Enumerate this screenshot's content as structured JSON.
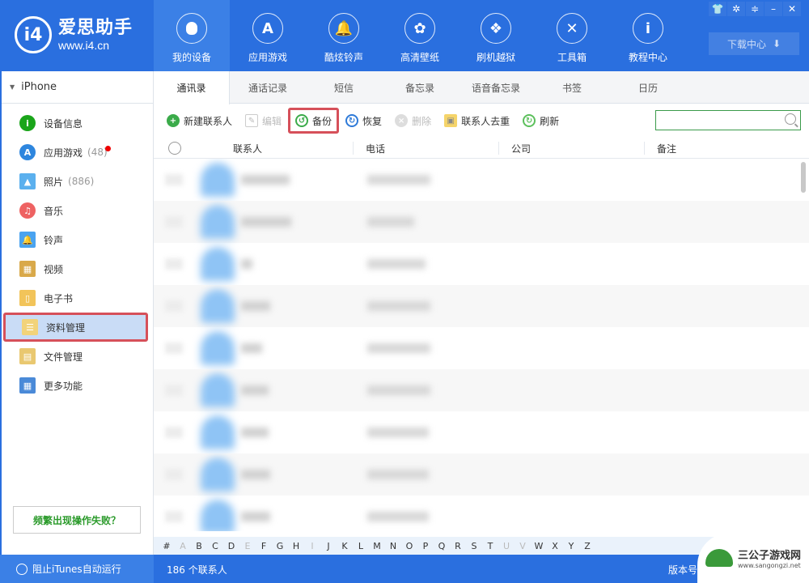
{
  "app": {
    "logo_mark": "i4",
    "logo_title": "爱思助手",
    "logo_url": "www.i4.cn"
  },
  "nav": [
    {
      "label": "我的设备",
      "icon": "apple-icon",
      "glyph": "",
      "active": true
    },
    {
      "label": "应用游戏",
      "icon": "app-store-icon",
      "glyph": "A"
    },
    {
      "label": "酷炫铃声",
      "icon": "bell-icon",
      "glyph": "🔔"
    },
    {
      "label": "高清壁纸",
      "icon": "flower-icon",
      "glyph": "✿"
    },
    {
      "label": "刷机越狱",
      "icon": "box-icon",
      "glyph": "❖"
    },
    {
      "label": "工具箱",
      "icon": "tools-icon",
      "glyph": "✕"
    },
    {
      "label": "教程中心",
      "icon": "info-icon",
      "glyph": "i"
    }
  ],
  "window_controls": {
    "skin": "👕",
    "settings": "✲",
    "menu": "≑",
    "minimize": "–",
    "close": "✕"
  },
  "download_center": {
    "label": "下载中心",
    "icon": "⬇"
  },
  "sidebar": {
    "device": "iPhone",
    "items": [
      {
        "label": "设备信息",
        "icon": "info-circle-icon",
        "glyph": "i",
        "color": "#1aa51a"
      },
      {
        "label": "应用游戏",
        "count": "(48)",
        "icon": "app-store-icon",
        "glyph": "A",
        "color": "#2e86de",
        "badge": true
      },
      {
        "label": "照片",
        "count": "(886)",
        "icon": "photo-icon",
        "glyph": "▲",
        "color": "#5bb0ee"
      },
      {
        "label": "音乐",
        "icon": "music-icon",
        "glyph": "♫",
        "color": "#ee6262"
      },
      {
        "label": "铃声",
        "icon": "bell-icon",
        "glyph": "🔔",
        "color": "#4aa3f0"
      },
      {
        "label": "视频",
        "icon": "video-icon",
        "glyph": "▦",
        "color": "#d9a94a"
      },
      {
        "label": "电子书",
        "icon": "book-icon",
        "glyph": "▯",
        "color": "#f2c45a"
      },
      {
        "label": "资料管理",
        "icon": "data-icon",
        "glyph": "☰",
        "color": "#f2d37a",
        "active": true
      },
      {
        "label": "文件管理",
        "icon": "file-icon",
        "glyph": "▤",
        "color": "#e9c870"
      },
      {
        "label": "更多功能",
        "icon": "grid-icon",
        "glyph": "▦",
        "color": "#4a8ad8"
      }
    ],
    "help_label": "频繁出现操作失败？"
  },
  "tabs": [
    "通讯录",
    "通话记录",
    "短信",
    "备忘录",
    "语音备忘录",
    "书签",
    "日历"
  ],
  "toolbar": {
    "new_contact": "新建联系人",
    "edit": "编辑",
    "backup": "备份",
    "restore": "恢复",
    "delete": "删除",
    "dedupe": "联系人去重",
    "refresh": "刷新",
    "search_placeholder": ""
  },
  "columns": [
    "联系人",
    "电话",
    "公司",
    "备注"
  ],
  "rows_blurred": [
    {
      "name_w": 60,
      "phone_w": 78
    },
    {
      "name_w": 62,
      "phone_w": 58
    },
    {
      "name_w": 14,
      "phone_w": 72
    },
    {
      "name_w": 36,
      "phone_w": 78
    },
    {
      "name_w": 26,
      "phone_w": 78
    },
    {
      "name_w": 34,
      "phone_w": 78
    },
    {
      "name_w": 34,
      "phone_w": 76
    },
    {
      "name_w": 36,
      "phone_w": 76
    },
    {
      "name_w": 36,
      "phone_w": 76
    }
  ],
  "alphabet": [
    {
      "c": "#"
    },
    {
      "c": "A",
      "dim": true
    },
    {
      "c": "B"
    },
    {
      "c": "C"
    },
    {
      "c": "D"
    },
    {
      "c": "E",
      "dim": true
    },
    {
      "c": "F"
    },
    {
      "c": "G"
    },
    {
      "c": "H"
    },
    {
      "c": "I",
      "dim": true
    },
    {
      "c": "J"
    },
    {
      "c": "K"
    },
    {
      "c": "L"
    },
    {
      "c": "M"
    },
    {
      "c": "N"
    },
    {
      "c": "O"
    },
    {
      "c": "P"
    },
    {
      "c": "Q"
    },
    {
      "c": "R"
    },
    {
      "c": "S"
    },
    {
      "c": "T"
    },
    {
      "c": "U",
      "dim": true
    },
    {
      "c": "V",
      "dim": true
    },
    {
      "c": "W"
    },
    {
      "c": "X"
    },
    {
      "c": "Y"
    },
    {
      "c": "Z"
    }
  ],
  "status": {
    "itunes_toggle": "阻止iTunes自动运行",
    "contact_count": "186 个联系人",
    "version_label": "版本号"
  },
  "watermark": {
    "title": "三公子游戏网",
    "url": "www.sangongzi.net"
  }
}
